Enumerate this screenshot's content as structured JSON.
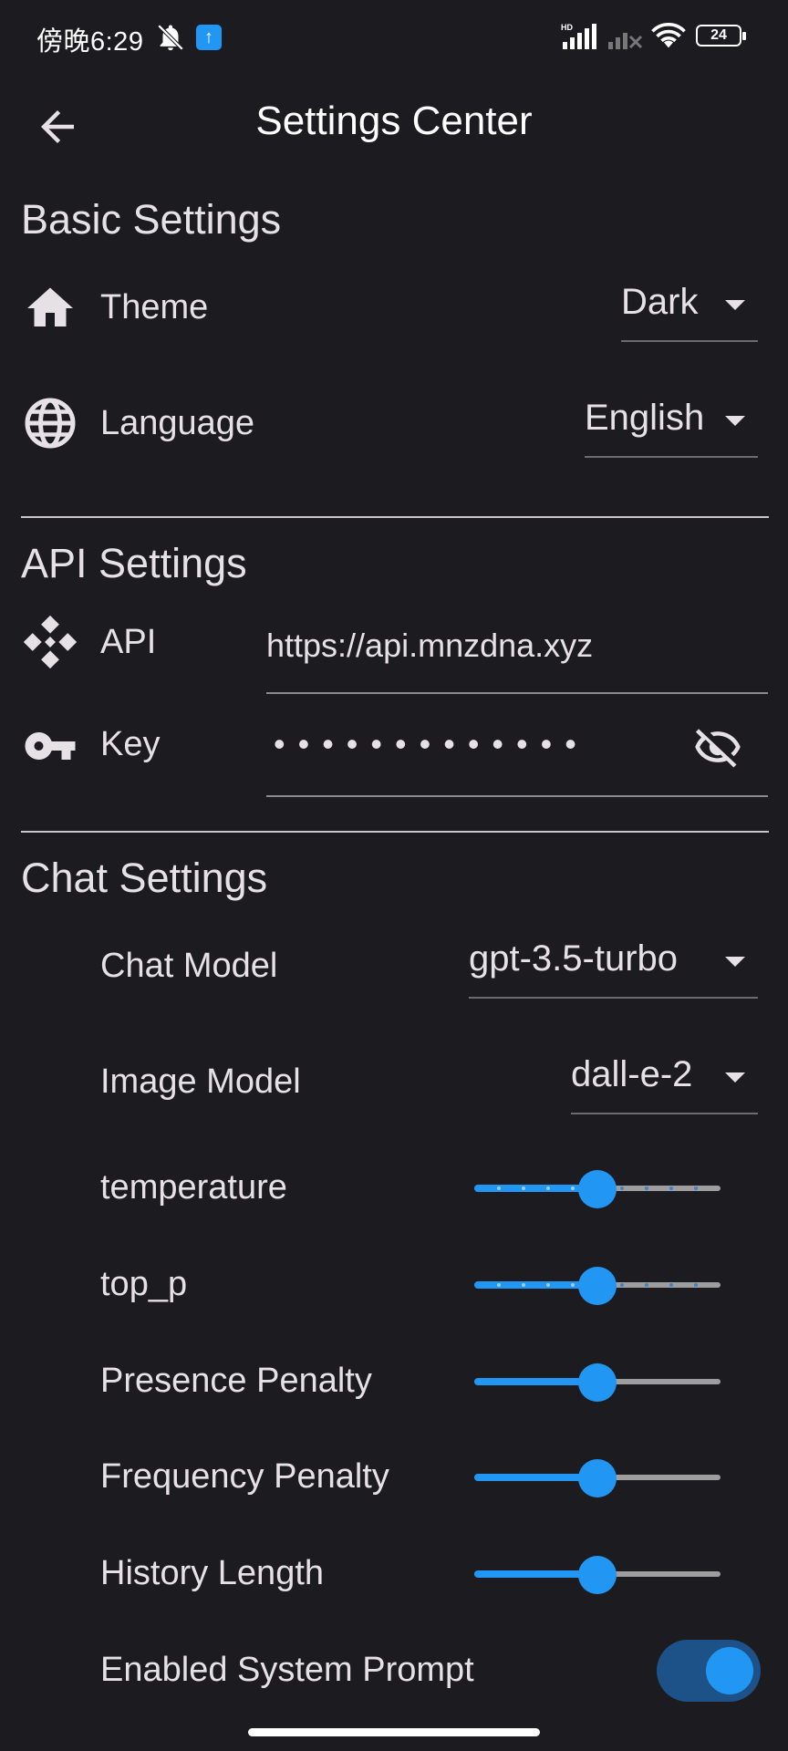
{
  "status_bar": {
    "time": "傍晚6:29",
    "battery": "24"
  },
  "app_bar": {
    "title": "Settings Center"
  },
  "sections": {
    "basic": {
      "title": "Basic Settings",
      "theme_label": "Theme",
      "theme_value": "Dark",
      "language_label": "Language",
      "language_value": "English"
    },
    "api": {
      "title": "API Settings",
      "api_label": "API",
      "api_value": "https://api.mnzdna.xyz",
      "key_label": "Key",
      "key_mask": "•••••••••••••"
    },
    "chat": {
      "title": "Chat Settings",
      "chat_model_label": "Chat Model",
      "chat_model_value": "gpt-3.5-turbo",
      "image_model_label": "Image Model",
      "image_model_value": "dall-e-2",
      "sliders": [
        {
          "label": "temperature",
          "value": 0.5,
          "discrete": true
        },
        {
          "label": "top_p",
          "value": 0.5,
          "discrete": true
        },
        {
          "label": "Presence Penalty",
          "value": 0.5,
          "discrete": false
        },
        {
          "label": "Frequency Penalty",
          "value": 0.5,
          "discrete": false
        },
        {
          "label": "History Length",
          "value": 0.5,
          "discrete": false
        }
      ],
      "system_prompt_label": "Enabled System Prompt",
      "system_prompt_enabled": true
    }
  },
  "icons": {
    "back": "arrow-back-icon",
    "theme": "home-icon",
    "language": "globe-icon",
    "api": "diamond-grid-icon",
    "key": "key-icon",
    "visibility": "visibility-off-icon"
  },
  "colors": {
    "background": "#1c1b1f",
    "accent": "#2196f3",
    "switch_track": "#1d5288"
  }
}
